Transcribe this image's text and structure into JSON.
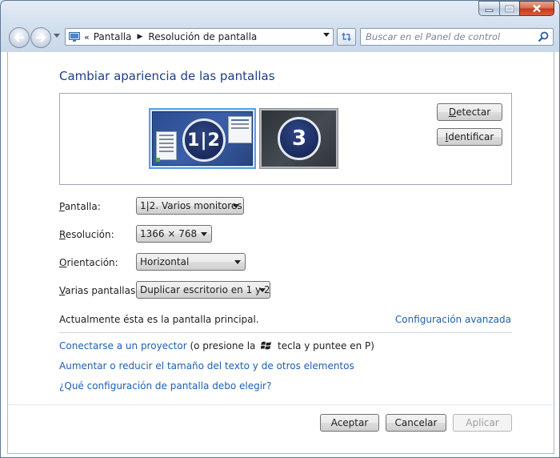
{
  "window": {
    "caption": {
      "minimize_icon": "minimize-icon",
      "maximize_icon": "maximize-icon",
      "close_icon": "close-icon"
    }
  },
  "navbar": {
    "breadcrumb_chevron": "«",
    "breadcrumb": [
      "Pantalla",
      "Resolución de pantalla"
    ],
    "breadcrumb_separator": "▶",
    "search_placeholder": "Buscar en el Panel de control"
  },
  "main": {
    "title": "Cambiar apariencia de las pantallas",
    "monitors": [
      {
        "label": "1|2",
        "selected": true
      },
      {
        "label": "3",
        "selected": false
      }
    ],
    "detect_button": {
      "prefix": "",
      "accel": "D",
      "rest": "etectar"
    },
    "identify_button": {
      "prefix": "",
      "accel": "I",
      "rest": "dentificar"
    },
    "settings": {
      "pantalla": {
        "label_accel": "P",
        "label_rest": "antalla:",
        "value": "1|2. Varios monitores"
      },
      "resolucion": {
        "label_accel": "R",
        "label_rest": "esolución:",
        "value": "1366 × 768"
      },
      "orientacion": {
        "label_accel": "O",
        "label_rest": "rientación:",
        "value": "Horizontal"
      },
      "varias": {
        "label_accel": "V",
        "label_rest": "arias pantallas:",
        "value": "Duplicar escritorio en 1 y 2"
      }
    },
    "status_text": "Actualmente ésta es la pantalla principal.",
    "advanced_link": "Configuración avanzada",
    "links": {
      "projector_link": "Conectarse a un proyector",
      "projector_hint_a": " (o presione la ",
      "projector_hint_b": " tecla y puntee en P)",
      "text_size_link": "Aumentar o reducir el tamaño del texto y de otros elementos",
      "which_settings_link": "¿Qué configuración de pantalla debo elegir?"
    }
  },
  "footer": {
    "accept": "Aceptar",
    "cancel": "Cancelar",
    "apply": "Aplicar"
  },
  "colors": {
    "link": "#1e5fb3",
    "title": "#1e3f86",
    "selected_border": "#5a9ee4"
  }
}
